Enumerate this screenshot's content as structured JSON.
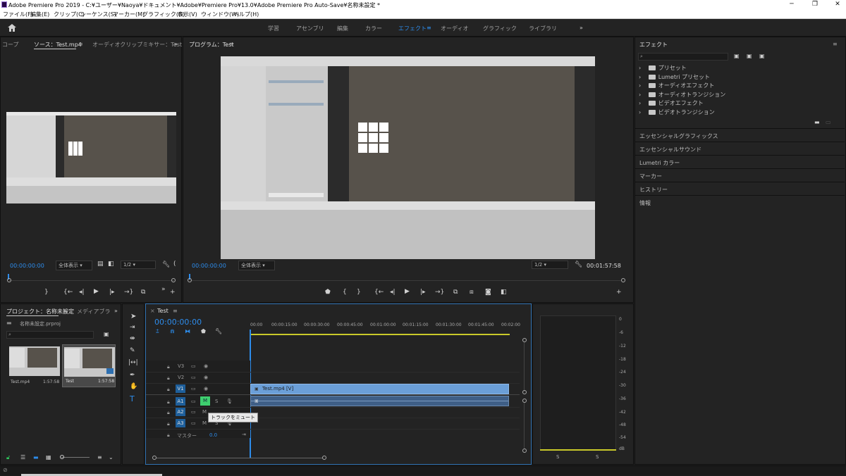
{
  "window": {
    "title": "Adobe Premiere Pro 2019 - C:¥ユーザー¥Naoya¥ドキュメント¥Adobe¥Premiere Pro¥13.0¥Adobe Premiere Pro Auto-Save¥名称未設定 *",
    "minimize": "─",
    "maximize": "❐",
    "close": "✕"
  },
  "menu": [
    "ファイル(F)",
    "編集(E)",
    "クリップ(C)",
    "シーケンス(S)",
    "マーカー(M)",
    "グラフィック(G)",
    "表示(V)",
    "ウィンドウ(W)",
    "ヘルプ(H)"
  ],
  "workspaces": [
    "学習",
    "アセンブリ",
    "編集",
    "カラー",
    "エフェクト",
    "オーディオ",
    "グラフィック",
    "ライブラリ"
  ],
  "workspace_active": "エフェクト",
  "workspace_more": "»",
  "source": {
    "tab_scope": "コープ",
    "tab_source": "ソース：Test.mp4",
    "tab_audio": "オーディオクリップミキサー：Test",
    "more": "»",
    "timecode": "00:00:00:00",
    "zoom": "全体表示",
    "res": "1/2"
  },
  "program": {
    "tab": "プログラム：Test",
    "timecode": "00:00:00:00",
    "zoom": "全体表示",
    "res": "1/2",
    "duration": "00:01:57:58"
  },
  "effects": {
    "title": "エフェクト",
    "items": [
      "プリセット",
      "Lumetri プリセット",
      "オーディオエフェクト",
      "オーディオトランジション",
      "ビデオエフェクト",
      "ビデオトランジション"
    ],
    "sections": [
      "エッセンシャルグラフィックス",
      "エッセンシャルサウンド",
      "Lumetri カラー",
      "マーカー",
      "ヒストリー",
      "情報"
    ]
  },
  "project": {
    "tab": "プロジェクト：名称未設定",
    "tab_media": "メディアブラ",
    "more": "»",
    "file": "名称未設定.prproj",
    "items": [
      {
        "name": "Test.mp4",
        "duration": "1:57:58"
      },
      {
        "name": "Test",
        "duration": "1:57:58"
      }
    ]
  },
  "timeline": {
    "tab": "Test",
    "timecode": "00:00:00:00",
    "ruler": [
      "00:00",
      "00:00:15:00",
      "00:00:30:00",
      "00:00:45:00",
      "00:01:00:00",
      "00:01:15:00",
      "00:01:30:00",
      "00:01:45:00",
      "00:02:00"
    ],
    "video_tracks": [
      "V3",
      "V2",
      "V1"
    ],
    "audio_tracks": [
      "A1",
      "A2",
      "A3"
    ],
    "master_label": "マスター",
    "master_value": "0.0",
    "clip_label": "Test.mp4 [V]",
    "mute_label": "M",
    "solo_label": "S",
    "tooltip": "トラックをミュート"
  },
  "meter": {
    "labels": [
      "0",
      "-6",
      "-12",
      "-18",
      "-24",
      "-30",
      "-36",
      "-42",
      "-48",
      "-54",
      "dB"
    ],
    "solo_left": "S",
    "solo_right": "S"
  }
}
